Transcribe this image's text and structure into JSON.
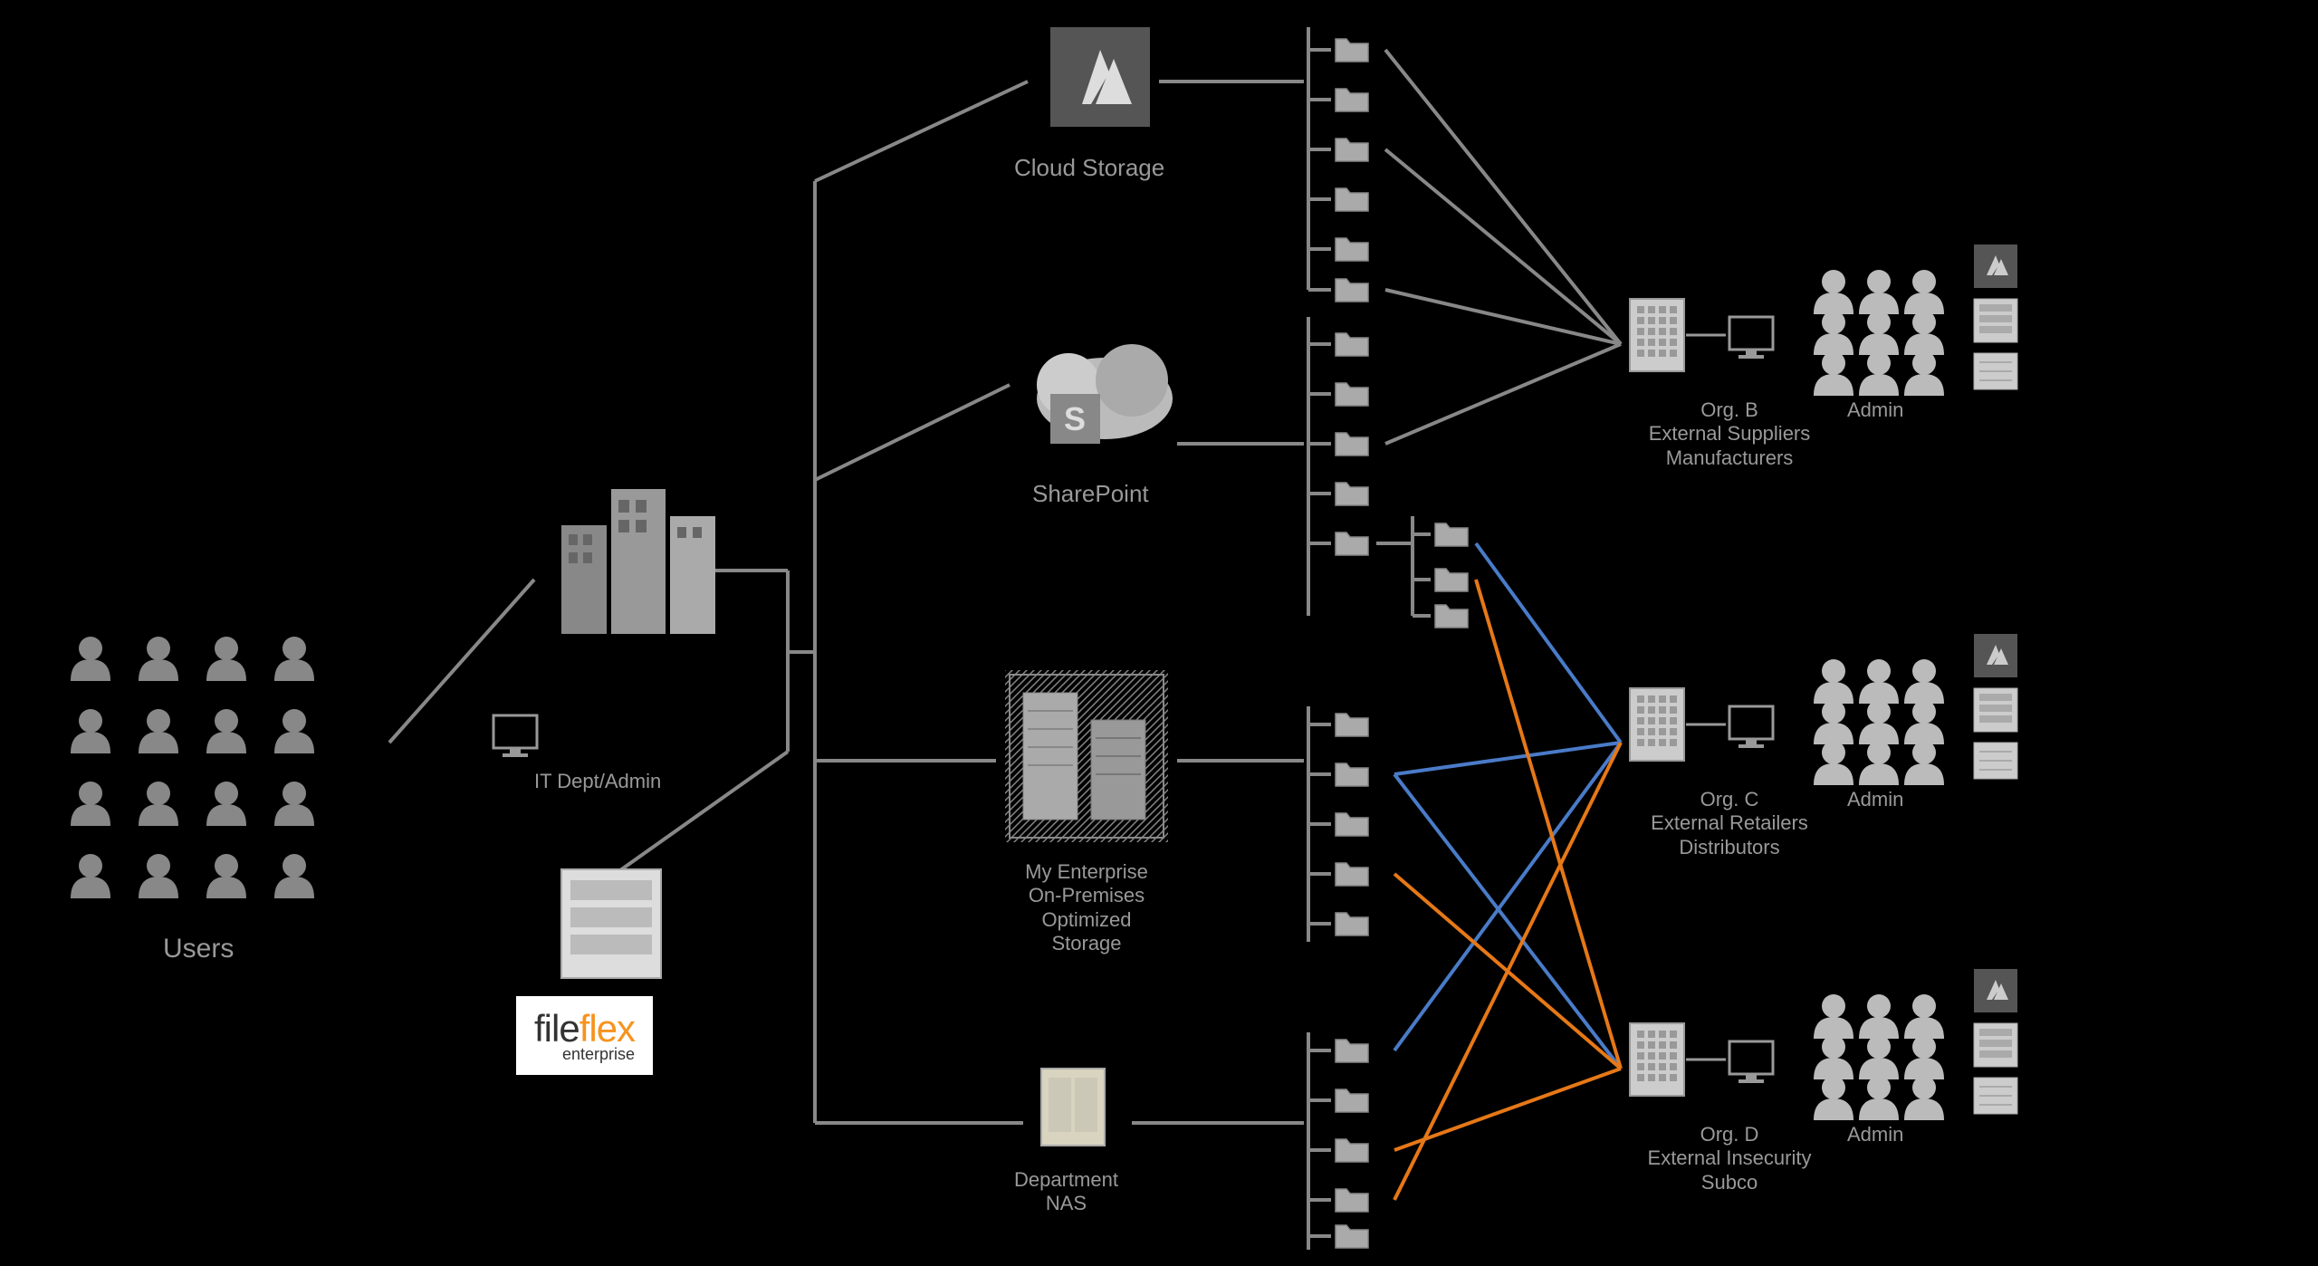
{
  "users_label": "Users",
  "it_admin": "IT Dept/Admin",
  "fileflex_brand1": "file",
  "fileflex_brand2": "flex",
  "fileflex_sub": "enterprise",
  "cloud_storage": "Cloud Storage",
  "sharepoint": "SharePoint",
  "datacenter": "My Enterprise\nOn-Premises\nOptimized\nStorage",
  "dept_nas": "Department\nNAS",
  "org_b": "Org. B\nExternal Suppliers\nManufacturers",
  "org_c": "Org. C\nExternal Retailers\nDistributors",
  "org_d": "Org. D\nExternal Insecurity\nSubco",
  "admin": "Admin"
}
